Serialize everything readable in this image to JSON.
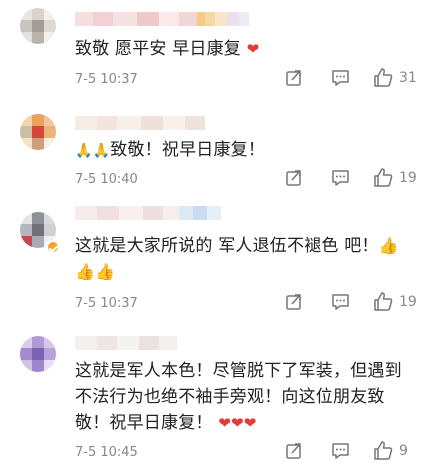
{
  "comments": [
    {
      "text": "致敬 愿平安 早日康复",
      "emoji_suffix": "❤",
      "time": "7-5 10:37",
      "likes": "31"
    },
    {
      "emoji_prefix": "🙏🙏",
      "text": "致敬！祝早日康复！",
      "time": "7-5 10:40",
      "likes": "19"
    },
    {
      "text": "这就是大家所说的 军人退伍不褪色 吧！",
      "emoji_suffix": "👍",
      "emoji_line2": "👍👍",
      "time": "7-5 10:37",
      "likes": "19"
    },
    {
      "text_line1": "这就是军人本色！尽管脱下了军装，但遇到",
      "text_line2": "不法行为也绝不袖手旁观！向这位朋友致",
      "text_line3": "敬！祝早日康复！",
      "emoji_suffix": "❤❤❤",
      "time": "7-5 10:45",
      "likes": "9"
    }
  ],
  "icons": {
    "share": "share-icon",
    "comment": "comment-icon",
    "like": "thumbs-up-icon"
  },
  "colors": {
    "heart": "#e53935",
    "badge": "#f5a623",
    "time": "#888888"
  }
}
